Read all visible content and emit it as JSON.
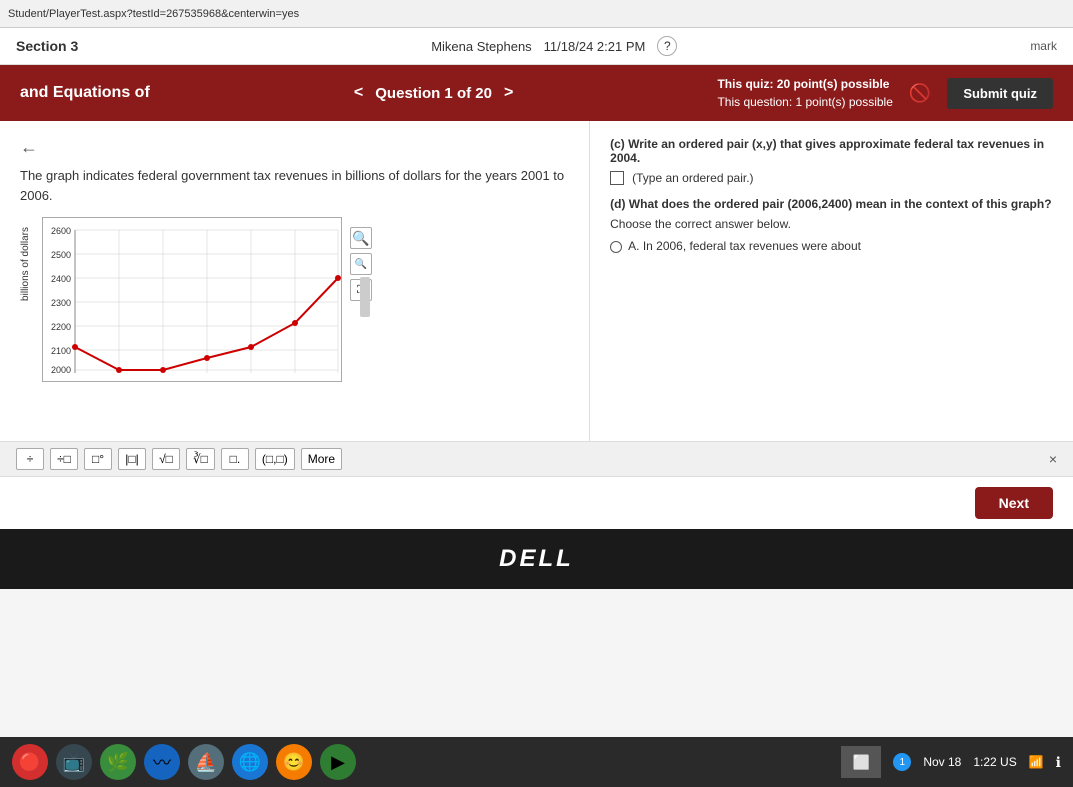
{
  "browser": {
    "url": "Student/PlayerTest.aspx?testId=267535968&centerwin=yes"
  },
  "header": {
    "section": "Section 3",
    "user": "Mikena Stephens",
    "datetime": "11/18/24 2:21 PM",
    "mark_label": "mark"
  },
  "quiz_header": {
    "title": "and Equations of",
    "question_nav": "Question 1 of 20",
    "nav_prev": "<",
    "nav_next": ">",
    "points_line1": "This quiz: 20 point(s) possible",
    "points_line2": "This question: 1 point(s) possible",
    "submit_label": "Submit quiz"
  },
  "question": {
    "text": "The graph indicates federal government tax revenues in billions of dollars for the years 2001 to 2006.",
    "part_c_label": "(c) Write an ordered pair (x,y) that gives approximate federal tax revenues in 2004.",
    "part_c_input_label": "(Type an ordered pair.)",
    "part_d_label": "(d) What does the ordered pair (2006,2400) mean in the context of this graph?",
    "choose_label": "Choose the correct answer below.",
    "option_a": "A.  In 2006, federal tax revenues were about"
  },
  "graph": {
    "y_labels": [
      "2600",
      "2500",
      "2400",
      "2300",
      "2200",
      "2100",
      "2000"
    ],
    "y_axis_title": "billions of dollars"
  },
  "math_toolbar": {
    "buttons": [
      "÷",
      "÷□",
      "□°",
      "|□|",
      "√□",
      "∛□",
      "□.",
      "(□,□)",
      "More"
    ],
    "close": "×"
  },
  "navigation": {
    "next_label": "Next"
  },
  "taskbar": {
    "icons": [
      "🔴",
      "📺",
      "🌿",
      "〰",
      "⛵",
      "🌐",
      "😊",
      "▶"
    ],
    "date": "Nov 18",
    "time": "1:22 US",
    "notification": "1"
  },
  "dell_logo": "DELL"
}
